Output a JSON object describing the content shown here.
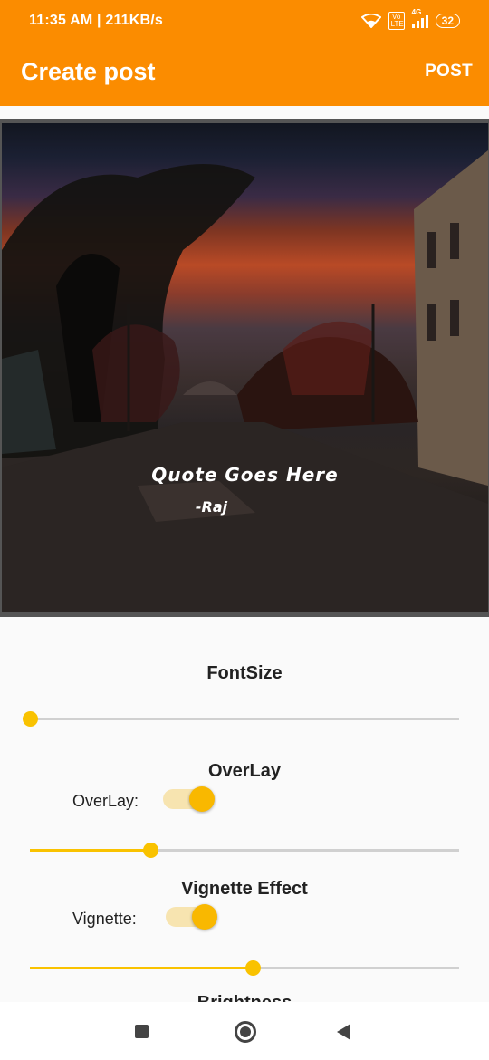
{
  "status_bar": {
    "time_speed": "11:35 AM | 211KB/s",
    "network": "4G",
    "volte": "Vo LTE",
    "battery": "32"
  },
  "app_bar": {
    "title": "Create post",
    "post_label": "POST",
    "color": "#fb8c00"
  },
  "preview": {
    "quote_text": "Quote Goes Here",
    "author": "-Raj"
  },
  "controls": {
    "font_size": {
      "label": "FontSize",
      "value_fraction": 0.0
    },
    "overlay": {
      "label": "OverLay",
      "toggle_label": "OverLay:",
      "enabled": true,
      "value_fraction": 0.28
    },
    "vignette": {
      "label": "Vignette Effect",
      "toggle_label": "Vignette:",
      "enabled": true,
      "value_fraction": 0.52
    },
    "brightness": {
      "label": "Brightness"
    }
  },
  "accent_color": "#f9c200",
  "nav": {
    "icons": [
      "recents-icon",
      "home-icon",
      "back-icon"
    ]
  }
}
